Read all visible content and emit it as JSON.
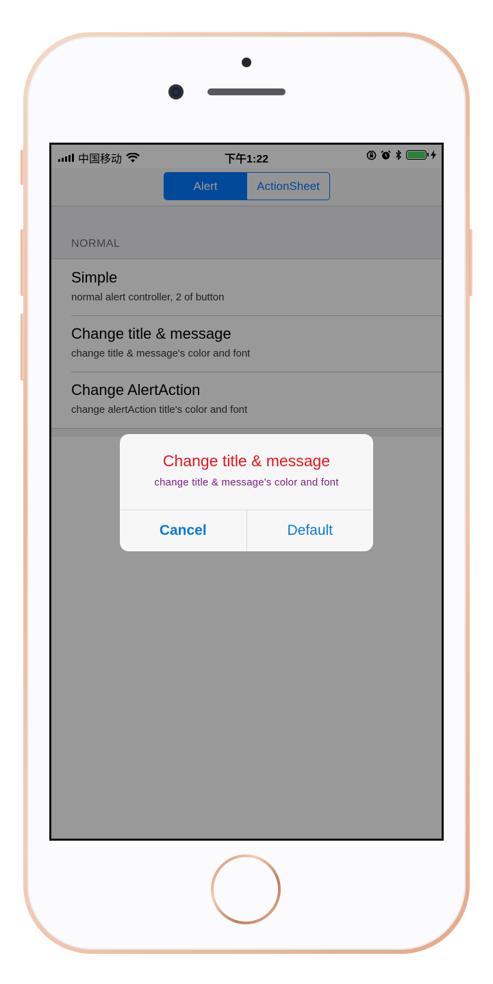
{
  "status_bar": {
    "carrier": "中国移动",
    "time": "下午1:22",
    "battery_color": "#4cd964"
  },
  "segmented_control": {
    "segments": [
      "Alert",
      "ActionSheet"
    ],
    "selected": "Alert"
  },
  "section": {
    "header": "NORMAL"
  },
  "rows": [
    {
      "title": "Simple",
      "subtitle": "normal alert controller, 2 of button"
    },
    {
      "title": "Change title & message",
      "subtitle": "change title & message's color and font"
    },
    {
      "title": "Change AlertAction",
      "subtitle": "change alertAction title's color and font"
    }
  ],
  "alert": {
    "title": "Change title & message",
    "message": "change title & message's color and font",
    "title_color": "#e6151d",
    "message_color": "#7e1b86",
    "actions": [
      {
        "label": "Cancel",
        "style": "cancel"
      },
      {
        "label": "Default",
        "style": "default"
      }
    ]
  },
  "icons": [
    "signal-bars-icon",
    "wifi-icon",
    "orientation-lock-icon",
    "alarm-icon",
    "bluetooth-icon",
    "battery-icon",
    "charging-bolt-icon"
  ]
}
